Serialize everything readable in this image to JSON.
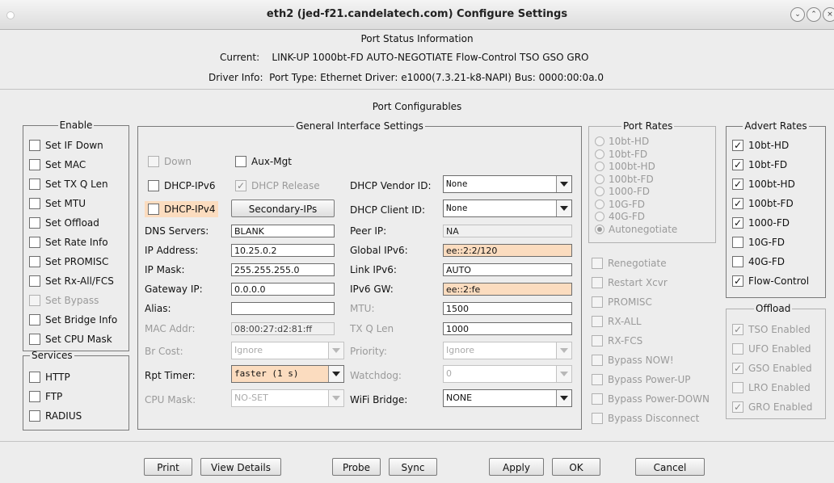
{
  "window": {
    "title": "eth2  (jed-f21.candelatech.com) Configure Settings"
  },
  "status": {
    "section_title": "Port Status Information",
    "current_label": "Current:",
    "current_value": "LINK-UP 1000bt-FD AUTO-NEGOTIATE Flow-Control TSO GSO GRO",
    "driver_label": "Driver Info:",
    "driver_value": "Port Type: Ethernet  Driver: e1000(7.3.21-k8-NAPI)  Bus: 0000:00:0a.0"
  },
  "configurables": {
    "section_title": "Port Configurables"
  },
  "enable": {
    "title": "Enable",
    "items": [
      {
        "label": "Set IF Down",
        "checked": false,
        "disabled": false
      },
      {
        "label": "Set MAC",
        "checked": false,
        "disabled": false
      },
      {
        "label": "Set TX Q Len",
        "checked": false,
        "disabled": false
      },
      {
        "label": "Set MTU",
        "checked": false,
        "disabled": false
      },
      {
        "label": "Set Offload",
        "checked": false,
        "disabled": false
      },
      {
        "label": "Set Rate Info",
        "checked": false,
        "disabled": false
      },
      {
        "label": "Set PROMISC",
        "checked": false,
        "disabled": false
      },
      {
        "label": "Set Rx-All/FCS",
        "checked": false,
        "disabled": false
      },
      {
        "label": "Set Bypass",
        "checked": false,
        "disabled": true
      },
      {
        "label": "Set Bridge Info",
        "checked": false,
        "disabled": false
      },
      {
        "label": "Set CPU Mask",
        "checked": false,
        "disabled": false
      }
    ]
  },
  "services": {
    "title": "Services",
    "items": [
      {
        "label": "HTTP",
        "checked": false
      },
      {
        "label": "FTP",
        "checked": false
      },
      {
        "label": "RADIUS",
        "checked": false
      }
    ]
  },
  "general": {
    "title": "General Interface Settings",
    "down": "Down",
    "aux_mgt": "Aux-Mgt",
    "dhcp_ipv6": "DHCP-IPv6",
    "dhcp_release": "DHCP Release",
    "dhcp_ipv4": "DHCP-IPv4",
    "secondary_ips": "Secondary-IPs",
    "dhcp_vendor_label": "DHCP Vendor ID:",
    "dhcp_vendor_value": "None",
    "dhcp_client_label": "DHCP Client ID:",
    "dhcp_client_value": "None",
    "dns_label": "DNS Servers:",
    "dns_value": "BLANK",
    "peer_label": "Peer IP:",
    "peer_value": "NA",
    "ip_label": "IP Address:",
    "ip_value": "10.25.0.2",
    "gipv6_label": "Global IPv6:",
    "gipv6_value": "ee::2:2/120",
    "mask_label": "IP Mask:",
    "mask_value": "255.255.255.0",
    "lipv6_label": "Link IPv6:",
    "lipv6_value": "AUTO",
    "gw_label": "Gateway IP:",
    "gw_value": "0.0.0.0",
    "ipv6gw_label": "IPv6 GW:",
    "ipv6gw_value": "ee::2:fe",
    "alias_label": "Alias:",
    "alias_value": "",
    "mtu_label": "MTU:",
    "mtu_value": "1500",
    "mac_label": "MAC Addr:",
    "mac_value": "08:00:27:d2:81:ff",
    "txq_label": "TX Q Len",
    "txq_value": "1000",
    "brcost_label": "Br Cost:",
    "brcost_value": "Ignore",
    "priority_label": "Priority:",
    "priority_value": "Ignore",
    "rpt_label": "Rpt Timer:",
    "rpt_value": "faster  (1 s)",
    "watchdog_label": "Watchdog:",
    "watchdog_value": "0",
    "cpumask_label": "CPU Mask:",
    "cpumask_value": "NO-SET",
    "wifi_label": "WiFi Bridge:",
    "wifi_value": "NONE"
  },
  "port_rates": {
    "title": "Port Rates",
    "items": [
      {
        "label": "10bt-HD",
        "selected": false
      },
      {
        "label": "10bt-FD",
        "selected": false
      },
      {
        "label": "100bt-HD",
        "selected": false
      },
      {
        "label": "100bt-FD",
        "selected": false
      },
      {
        "label": "1000-FD",
        "selected": false
      },
      {
        "label": "10G-FD",
        "selected": false
      },
      {
        "label": "40G-FD",
        "selected": false
      },
      {
        "label": "Autonegotiate",
        "selected": true
      }
    ]
  },
  "misc": {
    "items": [
      {
        "label": "Renegotiate",
        "checked": false
      },
      {
        "label": "Restart Xcvr",
        "checked": false
      },
      {
        "label": "PROMISC",
        "checked": false
      },
      {
        "label": "RX-ALL",
        "checked": false
      },
      {
        "label": "RX-FCS",
        "checked": false
      },
      {
        "label": "Bypass NOW!",
        "checked": false
      },
      {
        "label": "Bypass Power-UP",
        "checked": false
      },
      {
        "label": "Bypass Power-DOWN",
        "checked": false
      },
      {
        "label": "Bypass Disconnect",
        "checked": false
      }
    ]
  },
  "advert": {
    "title": "Advert Rates",
    "items": [
      {
        "label": "10bt-HD",
        "checked": true
      },
      {
        "label": "10bt-FD",
        "checked": true
      },
      {
        "label": "100bt-HD",
        "checked": true
      },
      {
        "label": "100bt-FD",
        "checked": true
      },
      {
        "label": "1000-FD",
        "checked": true
      },
      {
        "label": "10G-FD",
        "checked": false
      },
      {
        "label": "40G-FD",
        "checked": false
      },
      {
        "label": "Flow-Control",
        "checked": true
      }
    ]
  },
  "offload": {
    "title": "Offload",
    "items": [
      {
        "label": "TSO Enabled",
        "checked": true
      },
      {
        "label": "UFO Enabled",
        "checked": false
      },
      {
        "label": "GSO Enabled",
        "checked": true
      },
      {
        "label": "LRO Enabled",
        "checked": false
      },
      {
        "label": "GRO Enabled",
        "checked": true
      }
    ]
  },
  "buttons": {
    "print": "Print",
    "view_details": "View Details",
    "probe": "Probe",
    "sync": "Sync",
    "apply": "Apply",
    "ok": "OK",
    "cancel": "Cancel"
  },
  "icons": {
    "check": "✓"
  }
}
